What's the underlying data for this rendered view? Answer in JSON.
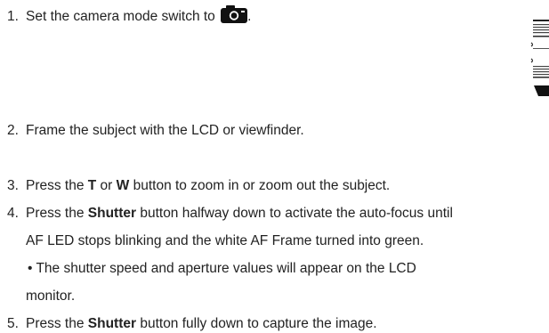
{
  "steps": [
    {
      "number": "1.",
      "text": "Set the camera mode switch to",
      "suffix": ".",
      "icon": "camera-icon"
    },
    {
      "number": "2.",
      "text": "Frame the subject with the LCD or viewfinder."
    },
    {
      "number": "3.",
      "pre": "Press the ",
      "bold1": "T",
      "mid": " or ",
      "bold2": "W",
      "post": " button to zoom in or zoom out the subject."
    },
    {
      "number": "4.",
      "pre": "Press the ",
      "bold": "Shutter",
      "post": " button halfway down to activate the auto-focus until",
      "line2": "AF LED stops blinking and the white AF Frame turned into green.",
      "bullet_line1": "• The shutter speed and aperture values will appear on the LCD",
      "bullet_line2": "monitor."
    },
    {
      "number": "5.",
      "pre": "Press the ",
      "bold": "Shutter",
      "post": " button fully down to capture the image."
    }
  ],
  "dial_icon": "mode-dial-icon"
}
